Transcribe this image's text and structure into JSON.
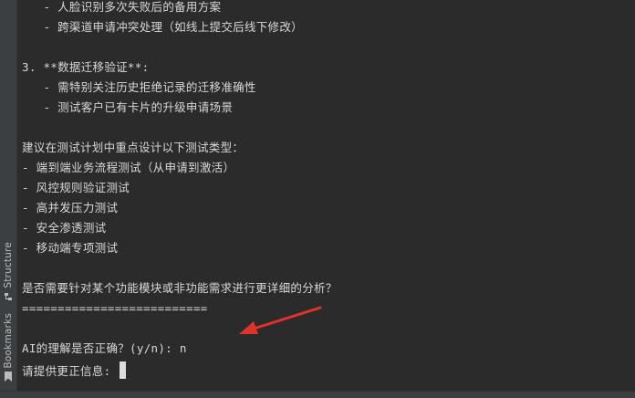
{
  "sidebar": {
    "structure_label": "Structure",
    "bookmarks_label": "Bookmarks"
  },
  "terminal": {
    "lines": [
      "   - 人脸识别多次失败后的备用方案",
      "   - 跨渠道申请冲突处理（如线上提交后线下修改）",
      "",
      "3. **数据迁移验证**:",
      "   - 需特别关注历史拒绝记录的迁移准确性",
      "   - 测试客户已有卡片的升级申请场景",
      "",
      "建议在测试计划中重点设计以下测试类型：",
      "- 端到端业务流程测试（从申请到激活）",
      "- 风控规则验证测试",
      "- 高并发压力测试",
      "- 安全渗透测试",
      "- 移动端专项测试",
      "",
      "是否需要针对某个功能模块或非功能需求进行更详细的分析？",
      "==========================",
      "",
      "AI的理解是否正确？(y/n): n",
      "请提供更正信息: "
    ]
  },
  "annotation": {
    "color": "#e0342b"
  }
}
